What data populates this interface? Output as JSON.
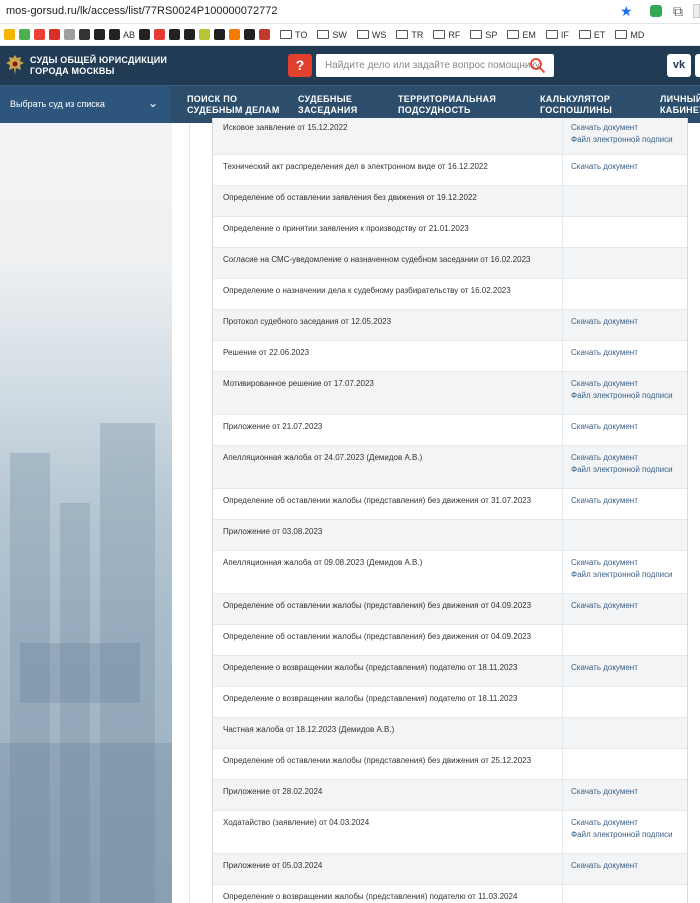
{
  "browser": {
    "url": "mos-gorsud.ru/lk/access/list/77RS0024P100000072772",
    "bookmarks": [
      {
        "label": "",
        "color": "#f4b400"
      },
      {
        "label": "",
        "color": "#4caf50"
      },
      {
        "label": "",
        "color": "#ea4335"
      },
      {
        "label": "",
        "color": "#d93025"
      },
      {
        "label": "",
        "color": "#9e9e9e"
      },
      {
        "label": "",
        "color": "#333333"
      },
      {
        "label": "",
        "color": "#222222"
      },
      {
        "label": "AB",
        "color": "#222222"
      },
      {
        "label": "",
        "color": "#222222"
      },
      {
        "label": "",
        "color": "#e53935"
      },
      {
        "label": "",
        "color": "#222222"
      },
      {
        "label": "",
        "color": "#222222"
      },
      {
        "label": "",
        "color": "#b8c33a"
      },
      {
        "label": "",
        "color": "#212121"
      },
      {
        "label": "",
        "color": "#f57c00"
      },
      {
        "label": "",
        "color": "#222222"
      },
      {
        "label": "",
        "color": "#c0392b"
      }
    ],
    "folders": [
      "TO",
      "SW",
      "WS",
      "TR",
      "RF",
      "SP",
      "EM",
      "IF",
      "ET",
      "MD"
    ]
  },
  "header": {
    "logo_line1": "СУДЫ ОБЩЕЙ ЮРИСДИКЦИИ",
    "logo_line2": "ГОРОДА МОСКВЫ",
    "help_label": "?",
    "search_placeholder": "Найдите дело или задайте вопрос помощнику",
    "vk_label": "vk"
  },
  "nav": {
    "court_select": "Выбрать суд из списка",
    "items": [
      {
        "line1": "ПОИСК ПО",
        "line2": "СУДЕБНЫМ ДЕЛАМ"
      },
      {
        "line1": "СУДЕБНЫЕ",
        "line2": "ЗАСЕДАНИЯ"
      },
      {
        "line1": "ТЕРРИТОРИАЛЬНАЯ",
        "line2": "ПОДСУДНОСТЬ"
      },
      {
        "line1": "КАЛЬКУЛЯТОР",
        "line2": "ГОСПОШЛИНЫ"
      },
      {
        "line1": "ЛИЧНЫЙ",
        "line2": "КАБИНЕТ"
      }
    ]
  },
  "links": {
    "download": "Скачать документ",
    "signature": "Файл электронной подписи"
  },
  "documents": [
    {
      "title": "Исковое заявление от 15.12.2022",
      "download": true,
      "signature": true
    },
    {
      "title": "Технический акт распределения дел в электронном виде от 16.12.2022",
      "download": true,
      "signature": false
    },
    {
      "title": "Определение об оставлении заявления без движения от 19.12.2022",
      "download": false,
      "signature": false
    },
    {
      "title": "Определение о принятии заявления к производству от 21.01.2023",
      "download": false,
      "signature": false
    },
    {
      "title": "Согласие на СМС-уведомление о назначенном судебном заседании от 16.02.2023",
      "download": false,
      "signature": false
    },
    {
      "title": "Определение о назначении дела к судебному разбирательству от 16.02.2023",
      "download": false,
      "signature": false
    },
    {
      "title": "Протокол судебного заседания от 12.05.2023",
      "download": true,
      "signature": false
    },
    {
      "title": "Решение от 22.06.2023",
      "download": true,
      "signature": false
    },
    {
      "title": "Мотивированное решение от 17.07.2023",
      "download": true,
      "signature": true
    },
    {
      "title": "Приложение от 21.07.2023",
      "download": true,
      "signature": false
    },
    {
      "title": "Апелляционная жалоба от 24.07.2023 (Демидов А.В.)",
      "download": true,
      "signature": true
    },
    {
      "title": "Определение об оставлении жалобы (представления) без движения от 31.07.2023",
      "download": true,
      "signature": false
    },
    {
      "title": "Приложение от 03.08.2023",
      "download": false,
      "signature": false
    },
    {
      "title": "Апелляционная жалоба от 09.08.2023 (Демидов А.В.)",
      "download": true,
      "signature": true
    },
    {
      "title": "Определение об оставлении жалобы (представления) без движения от 04.09.2023",
      "download": true,
      "signature": false
    },
    {
      "title": "Определение об оставлении жалобы (представления) без движения от 04.09.2023",
      "download": false,
      "signature": false
    },
    {
      "title": "Определение о возвращении жалобы (представления) подателю от 18.11.2023",
      "download": true,
      "signature": false
    },
    {
      "title": "Определение о возвращении жалобы (представления) подателю от 18.11.2023",
      "download": false,
      "signature": false
    },
    {
      "title": "Частная жалоба от 18.12.2023 (Демидов А.В.)",
      "download": false,
      "signature": false
    },
    {
      "title": "Определение об оставлении жалобы (представления) без движения от 25.12.2023",
      "download": false,
      "signature": false
    },
    {
      "title": "Приложение от 28.02.2024",
      "download": true,
      "signature": false
    },
    {
      "title": "Ходатайство (заявление) от 04.03.2024",
      "download": true,
      "signature": true
    },
    {
      "title": "Приложение от 05.03.2024",
      "download": true,
      "signature": false
    },
    {
      "title": "Определение о возвращении жалобы (представления) подателю от 11.03.2024",
      "download": false,
      "signature": false
    }
  ],
  "colors": {
    "header_bg": "#223b55",
    "nav_bg": "#2c4d6c",
    "link": "#3b5f85",
    "help_red": "#e2402e"
  }
}
